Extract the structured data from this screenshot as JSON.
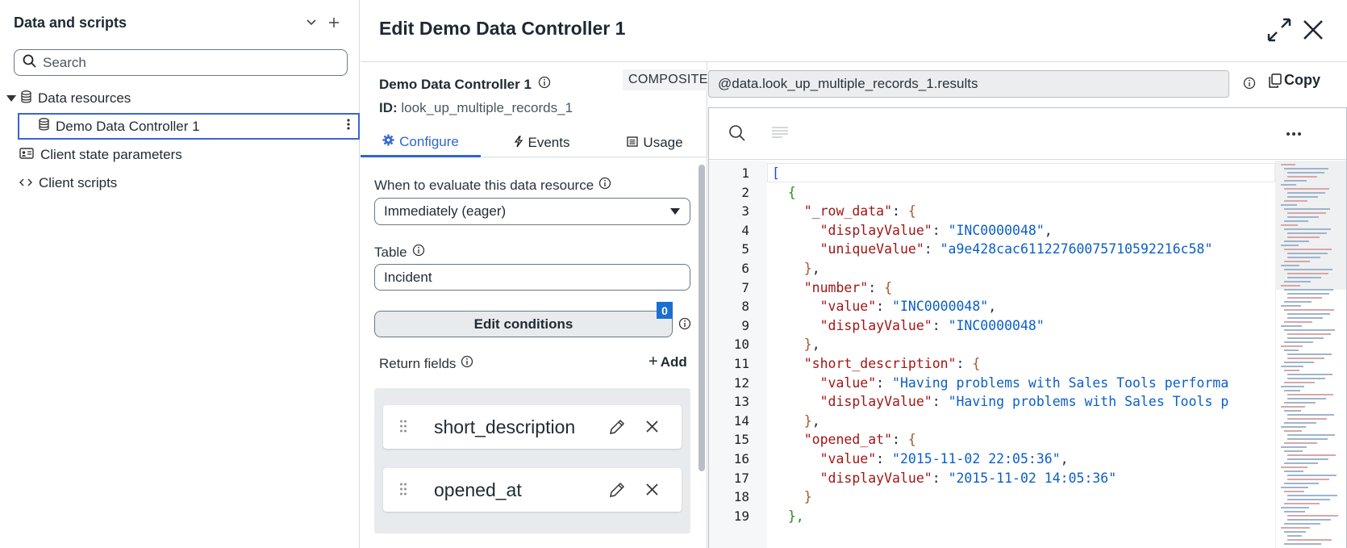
{
  "sidebar": {
    "title": "Data and scripts",
    "search_placeholder": "Search",
    "tree": {
      "data_resources": "Data resources",
      "controller": "Demo Data Controller 1",
      "client_state": "Client state parameters",
      "client_scripts": "Client scripts"
    }
  },
  "editor": {
    "title": "Edit Demo Data Controller 1"
  },
  "config": {
    "name": "Demo Data Controller 1",
    "badge": "COMPOSITE",
    "id_label": "ID:",
    "id_value": "look_up_multiple_records_1",
    "tabs": [
      {
        "label": "Configure",
        "icon": "gear-icon"
      },
      {
        "label": "Events",
        "icon": "bolt-icon"
      },
      {
        "label": "Usage",
        "icon": "list-icon"
      }
    ],
    "when_label": "When to evaluate this data resource",
    "when_value": "Immediately (eager)",
    "table_label": "Table",
    "table_value": "Incident",
    "edit_conditions": "Edit conditions",
    "conditions_count": "0",
    "return_fields_label": "Return fields",
    "add_label": "Add",
    "return_fields": [
      "short_description",
      "opened_at"
    ]
  },
  "output": {
    "path": "@data.look_up_multiple_records_1.results",
    "copy_label": "Copy",
    "line_numbers": [
      "1",
      "2",
      "3",
      "4",
      "5",
      "6",
      "7",
      "8",
      "9",
      "10",
      "11",
      "12",
      "13",
      "14",
      "15",
      "16",
      "17",
      "18",
      "19"
    ],
    "json": {
      "row_data_key": "\"_row_data\"",
      "displayValue_key": "\"displayValue\"",
      "uniqueValue_key": "\"uniqueValue\"",
      "number_key": "\"number\"",
      "value_key": "\"value\"",
      "short_description_key": "\"short_description\"",
      "opened_at_key": "\"opened_at\"",
      "inc": "\"INC0000048\"",
      "unique": "\"a9e428cac6112276007571059221 6c58\"",
      "desc_value": "\"Having problems with Sales Tools performa",
      "desc_display": "\"Having problems with Sales Tools p",
      "opened_value": "\"2015-11-02 22:05:36\"",
      "opened_display": "\"2015-11-02 14:05:36\""
    }
  },
  "colors": {
    "accent": "#2f66d0",
    "selection_border": "#3b64d6",
    "badge_blue": "#1b6fd1",
    "json_key": "#a31515",
    "json_string": "#0b5fc5"
  }
}
